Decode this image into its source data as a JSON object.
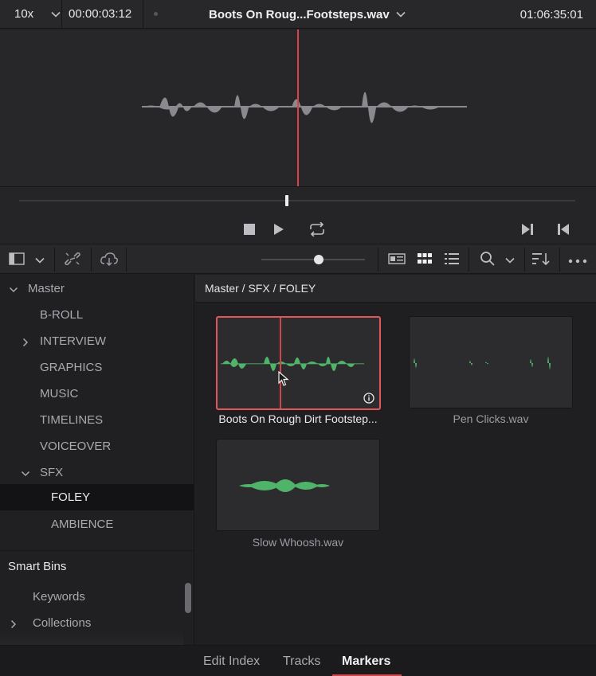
{
  "viewer": {
    "zoom": "10x",
    "timecode_left": "00:00:03:12",
    "clip_name": "Boots On Roug...Footsteps.wav",
    "timecode_right": "01:06:35:01"
  },
  "icons": {
    "stop": "stop-icon",
    "play": "play-icon",
    "loop": "loop-icon",
    "next": "skip-forward-icon",
    "prev": "skip-back-icon"
  },
  "sidebar": {
    "root": "Master",
    "bins": [
      {
        "label": "B-ROLL",
        "expandable": false
      },
      {
        "label": "INTERVIEW",
        "expandable": true
      },
      {
        "label": "GRAPHICS",
        "expandable": false
      },
      {
        "label": "MUSIC",
        "expandable": false
      },
      {
        "label": "TIMELINES",
        "expandable": false
      },
      {
        "label": "VOICEOVER",
        "expandable": false
      },
      {
        "label": "SFX",
        "expandable": true,
        "expanded": true
      },
      {
        "label": "FOLEY",
        "selected": true
      },
      {
        "label": "AMBIENCE"
      }
    ],
    "smart_bins": {
      "header": "Smart Bins",
      "items": [
        {
          "label": "Keywords"
        },
        {
          "label": "Collections"
        }
      ]
    }
  },
  "content": {
    "breadcrumb": "Master / SFX / FOLEY",
    "clips": [
      {
        "name": "Boots On Rough Dirt Footstep...",
        "selected": true
      },
      {
        "name": "Pen Clicks.wav",
        "selected": false
      },
      {
        "name": "Slow Whoosh.wav",
        "selected": false
      }
    ]
  },
  "bottom_tabs": [
    {
      "label": "Edit Index",
      "active": false
    },
    {
      "label": "Tracks",
      "active": false
    },
    {
      "label": "Markers",
      "active": true
    }
  ],
  "colors": {
    "accent": "#d8434a",
    "waveform_green": "#4fb36a",
    "waveform_grey": "#8a8a8e"
  }
}
